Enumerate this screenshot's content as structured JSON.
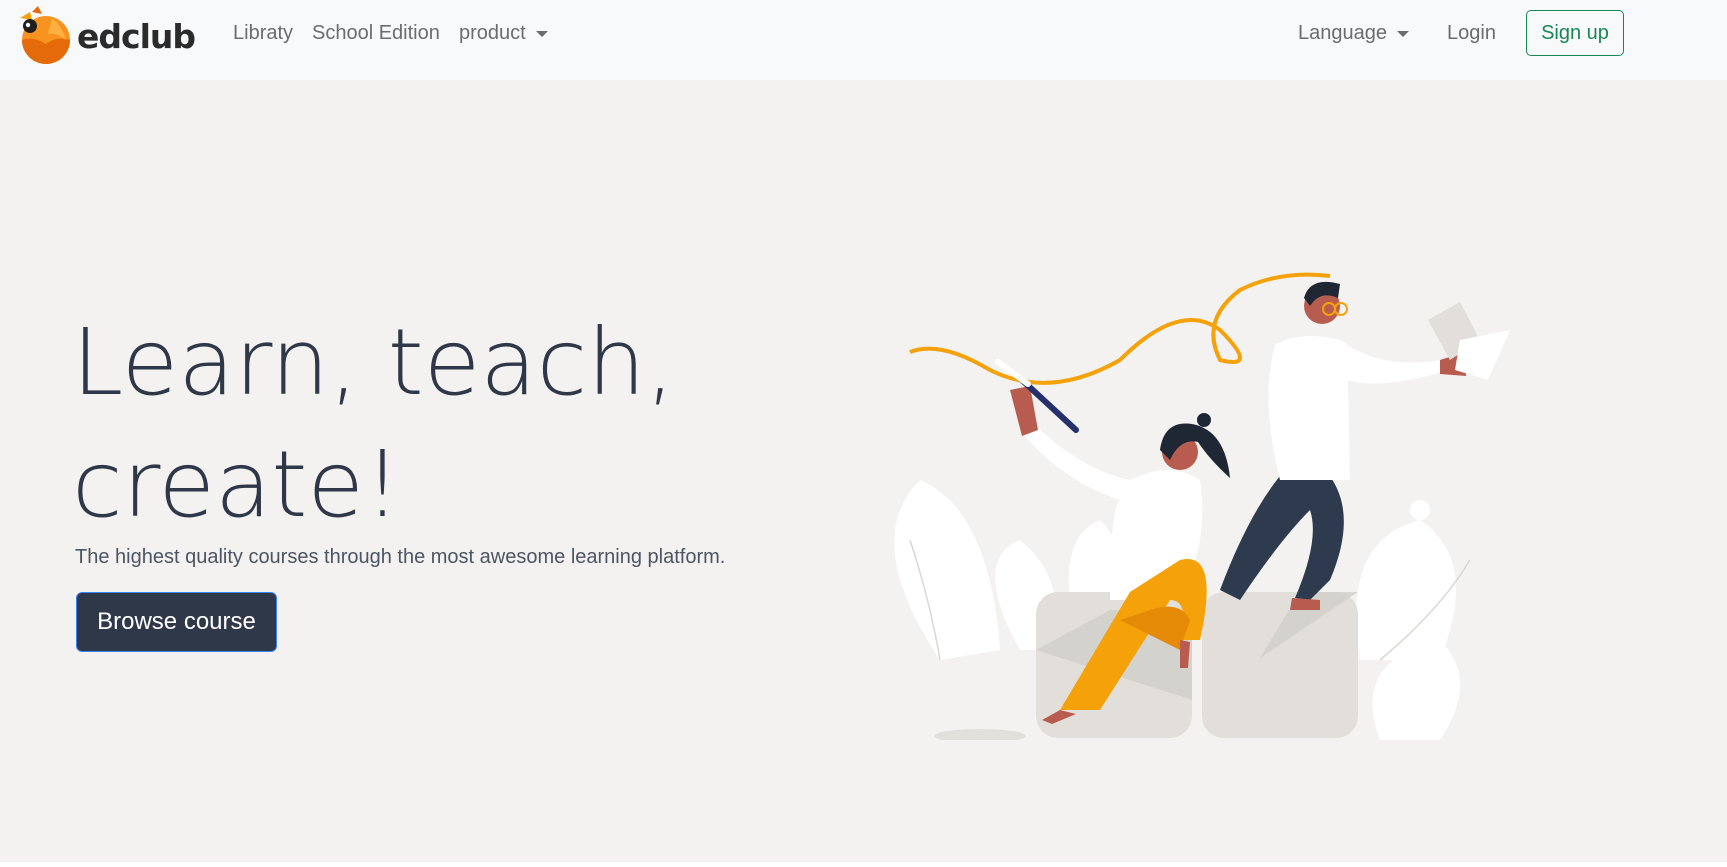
{
  "navbar": {
    "brand": "edclub",
    "links": [
      {
        "label": "Libraty"
      },
      {
        "label": "School Edition"
      },
      {
        "label": "product"
      }
    ],
    "language_label": "Language",
    "login_label": "Login",
    "signup_label": "Sign up"
  },
  "hero": {
    "headline": "Learn, teach, create!",
    "subtitle": "The highest quality courses through the most awesome learning platform.",
    "cta_label": "Browse course"
  },
  "colors": {
    "navbar_bg": "#f8f9fa",
    "hero_bg": "#f3f2f0",
    "primary_dark": "#2f3849",
    "signup_green": "#198754",
    "accent_orange": "#f5a20a"
  },
  "icons": {
    "logo": "edclub-bird-logo",
    "dropdown": "caret-down-icon",
    "illustration": "learning-people-illustration"
  }
}
